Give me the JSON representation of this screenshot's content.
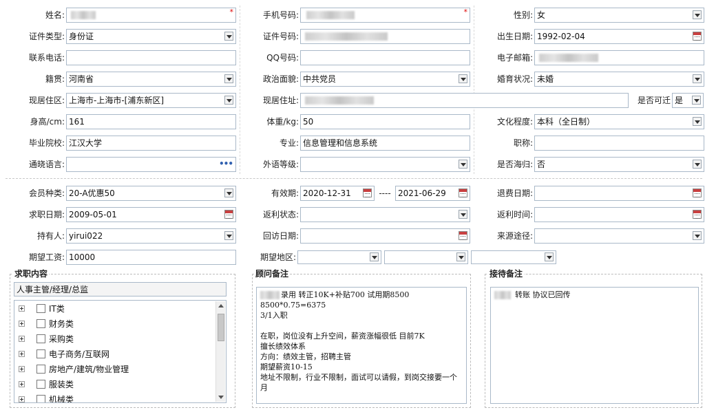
{
  "form": {
    "name": {
      "label": "姓名:",
      "value": ""
    },
    "phone": {
      "label": "手机号码:",
      "value": ""
    },
    "gender": {
      "label": "性别:",
      "value": "女"
    },
    "id_type": {
      "label": "证件类型:",
      "value": "身份证"
    },
    "id_number": {
      "label": "证件号码:",
      "value": ""
    },
    "birthdate": {
      "label": "出生日期:",
      "value": "1992-02-04"
    },
    "contact_phone": {
      "label": "联系电话:",
      "value": ""
    },
    "qq": {
      "label": "QQ号码:",
      "value": ""
    },
    "email": {
      "label": "电子邮箱:",
      "value": ""
    },
    "native_place": {
      "label": "籍贯:",
      "value": "河南省"
    },
    "political": {
      "label": "政治面貌:",
      "value": "中共党员"
    },
    "marital": {
      "label": "婚育状况:",
      "value": "未婚"
    },
    "residence_area": {
      "label": "现居住区:",
      "value": "上海市-上海市-[浦东新区]"
    },
    "address": {
      "label": "现居住址:",
      "value": ""
    },
    "relocate": {
      "label": "是否可迁",
      "value": "是"
    },
    "height": {
      "label": "身高/cm:",
      "value": "161"
    },
    "weight": {
      "label": "体重/kg:",
      "value": "50"
    },
    "education": {
      "label": "文化程度:",
      "value": "本科（全日制）"
    },
    "school": {
      "label": "毕业院校:",
      "value": "江汉大学"
    },
    "major": {
      "label": "专业:",
      "value": "信息管理和信息系统"
    },
    "title": {
      "label": "职称:",
      "value": ""
    },
    "languages": {
      "label": "通晓语言:",
      "value": ""
    },
    "foreign_level": {
      "label": "外语等级:",
      "value": ""
    },
    "returnee": {
      "label": "是否海归:",
      "value": "否"
    }
  },
  "membership": {
    "member_type": {
      "label": "会员种类:",
      "value": "20-A优惠50"
    },
    "valid_period": {
      "label": "有效期:",
      "start": "2020-12-31",
      "separator": "----",
      "end": "2021-06-29"
    },
    "refund_date": {
      "label": "退费日期:",
      "value": ""
    },
    "job_date": {
      "label": "求职日期:",
      "value": "2009-05-01"
    },
    "rebate_status": {
      "label": "返利状态:",
      "value": ""
    },
    "rebate_time": {
      "label": "返利时间:",
      "value": ""
    },
    "holder": {
      "label": "持有人:",
      "value": "yirui022"
    },
    "visit_date": {
      "label": "回访日期:",
      "value": ""
    },
    "source": {
      "label": "来源途径:",
      "value": ""
    },
    "salary": {
      "label": "期望工资:",
      "value": "10000"
    },
    "region": {
      "label": "期望地区:",
      "values": [
        "",
        "",
        ""
      ]
    }
  },
  "job_panel": {
    "title": "求职内容",
    "selected": "人事主管/经理/总监",
    "categories": [
      "IT类",
      "财务类",
      "采购类",
      "电子商务/互联网",
      "房地产/建筑/物业管理",
      "服装类",
      "机械类"
    ]
  },
  "consultant_panel": {
    "title": "顾问备注",
    "text": "录用 转正10K+补贴700 试用期8500\n8500*0.75=6375\n3/1入职\n\n在职，岗位没有上升空间，薪资涨幅很低 目前7K\n擅长绩效体系\n方向：绩效主管，招聘主管\n期望薪资10-15\n地址不限制，行业不限制，面试可以请假，到岗交接要一个月"
  },
  "reception_panel": {
    "title": "接待备注",
    "text": "转账 协议已回传"
  },
  "icons": {
    "dropdown": "chevron-down-icon",
    "calendar": "calendar-icon",
    "more": "ellipsis-icon",
    "expand": "plus-box-icon",
    "checkbox": "checkbox-icon"
  },
  "colors": {
    "required": "#dd0000",
    "border": "#a9b8c8",
    "calendar_accent": "#c94040"
  }
}
